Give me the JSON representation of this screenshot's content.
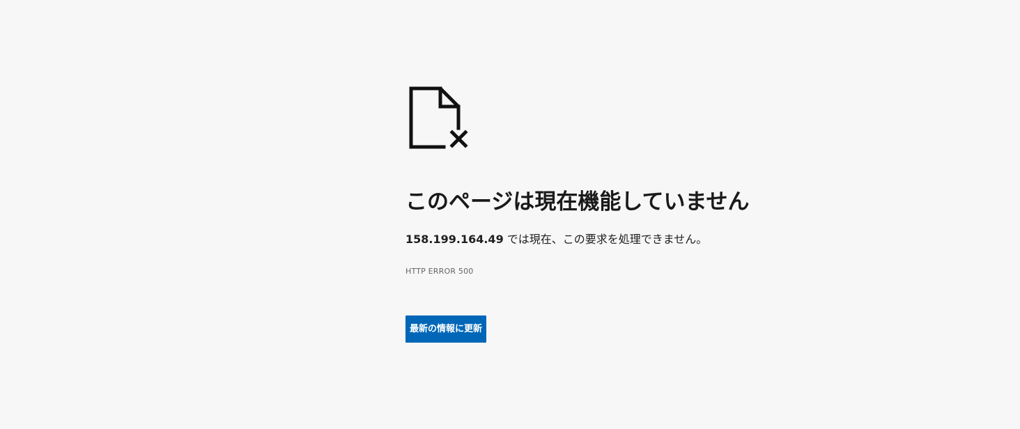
{
  "error_page": {
    "icon": "file-error-icon",
    "title": "このページは現在機能していません",
    "message": {
      "host": "158.199.164.49",
      "text": " では現在、この要求を処理できません。"
    },
    "error_code": "HTTP ERROR 500",
    "reload_button_label": "最新の情報に更新",
    "colors": {
      "background": "#f7f7f7",
      "button": "#0067b8",
      "button_text": "#ffffff",
      "title": "#1a1a1a",
      "error_code": "#646464"
    }
  }
}
